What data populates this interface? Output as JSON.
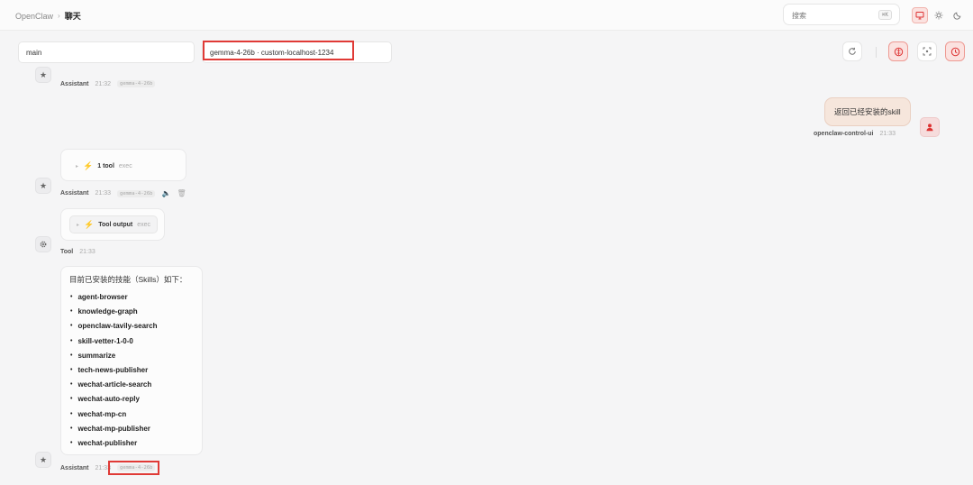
{
  "header": {
    "app_name": "OpenClaw",
    "separator": "›",
    "current_page": "聊天",
    "search_placeholder": "搜索",
    "search_shortcut": "⌘K",
    "monitor_icon": "monitor-icon",
    "sun_icon": "sun-icon",
    "moon_icon": "moon-icon"
  },
  "selectors": {
    "session": "main",
    "model": "gemma-4-26b · custom-localhost-1234"
  },
  "toolbar": {
    "refresh_icon": "refresh-icon",
    "brain_icon": "brain-icon",
    "focus_icon": "focus-icon",
    "history_icon": "clock-icon"
  },
  "messages": {
    "m1": {
      "role": "Assistant",
      "time": "21:32",
      "model": "gemma-4-26b"
    },
    "user": {
      "text": "返回已经安装的skill",
      "sender": "openclaw-control-ui",
      "time": "21:33"
    },
    "m2": {
      "tool_label": "1 tool",
      "tool_sub": "exec",
      "role": "Assistant",
      "time": "21:33",
      "model": "gemma-4-26b"
    },
    "m3": {
      "tool_label": "Tool output",
      "tool_sub": "exec",
      "role": "Tool",
      "time": "21:33"
    },
    "m4": {
      "intro": "目前已安装的技能（Skills）如下：",
      "skills": [
        "agent-browser",
        "knowledge-graph",
        "openclaw-tavily-search",
        "skill-vetter-1-0-0",
        "summarize",
        "tech-news-publisher",
        "wechat-article-search",
        "wechat-auto-reply",
        "wechat-mp-cn",
        "wechat-mp-publisher",
        "wechat-publisher"
      ],
      "role": "Assistant",
      "time": "21:33",
      "model": "gemma-4-26b"
    }
  },
  "colors": {
    "accent": "#e03a36",
    "user_bubble": "#f6e6dc",
    "background": "#f5f5f6"
  }
}
